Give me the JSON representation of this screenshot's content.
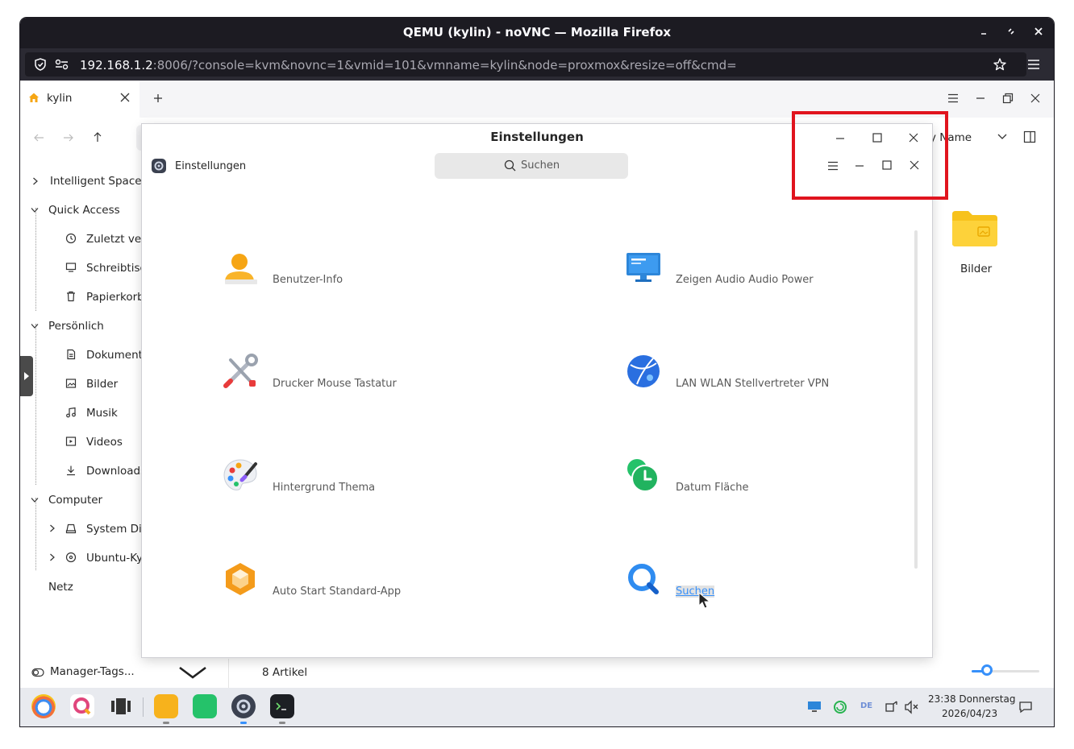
{
  "browser": {
    "title": "QEMU (kylin) - noVNC — Mozilla Firefox",
    "url_host": "192.168.1.2",
    "url_rest": ":8006/?console=kvm&novnc=1&vmid=101&vmname=kylin&node=proxmox&resize=off&cmd="
  },
  "filemanager": {
    "tab_label": "kylin",
    "sort_label": "y Name",
    "sidebar": {
      "intelligent_space": "Intelligent Space",
      "quick_access": "Quick Access",
      "recent": "Zuletzt verw",
      "desktop": "Schreibtisch",
      "trash": "Papierkorb",
      "personal": "Persönlich",
      "documents": "Dokumente",
      "pictures": "Bilder",
      "music": "Musik",
      "videos": "Videos",
      "downloads": "Downloads",
      "computer": "Computer",
      "system_disk": "System Disk",
      "ubuntu": "Ubuntu-Kyl",
      "network": "Netz"
    },
    "folder_bilder": "Bilder",
    "manager_tags": "Manager-Tags...",
    "item_count": "8 Artikel"
  },
  "settings": {
    "title": "Einstellungen",
    "app_label": "Einstellungen",
    "search_label": "Suchen",
    "categories": [
      {
        "label": "Benutzer-Info"
      },
      {
        "label": "Zeigen  Audio  Audio  Power"
      },
      {
        "label": "Drucker  Mouse  Tastatur"
      },
      {
        "label": "LAN  WLAN  Stellvertreter  VPN"
      },
      {
        "label": "Hintergrund  Thema"
      },
      {
        "label": "Datum  Fläche"
      },
      {
        "label": "Auto Start  Standard-App"
      },
      {
        "label": "Suchen"
      }
    ]
  },
  "taskbar": {
    "time": "23:38 Donnerstag",
    "date": "2026/04/23",
    "lang": "DE"
  },
  "colors": {
    "highlight": "#e0141e",
    "accent": "#3790fa"
  }
}
